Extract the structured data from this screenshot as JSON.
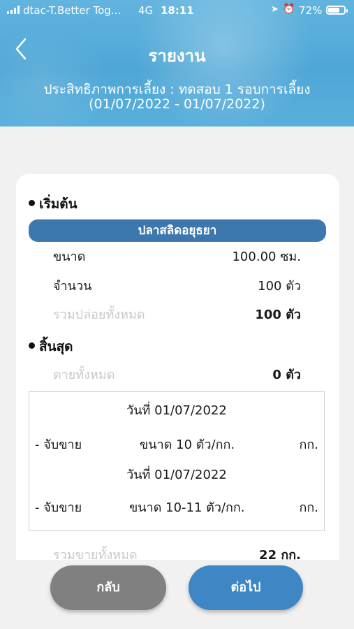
{
  "status_bar": {
    "carrier": "dtac-T.Better Tog...",
    "network": "4G",
    "time": "18:11",
    "battery": "72%",
    "battery_level": 0.72,
    "icons": [
      "signal-icon",
      "location-arrow-icon",
      "alarm-icon",
      "battery-icon"
    ]
  },
  "header": {
    "title": "รายงาน",
    "subtitle_line1": "ประสิทธิภาพการเลี้ยง : ทดสอบ 1 รอบการเลี้ยง",
    "subtitle_line2": "(01/07/2022 - 01/07/2022)",
    "back_icon": "chevron-left-icon"
  },
  "start_section": {
    "heading": "เริ่มต้น",
    "species": "ปลาสลิดอยุธยา",
    "size_label": "ขนาด",
    "size_value": "100.00 ซม.",
    "count_label": "จำนวน",
    "count_value": "100 ตัว",
    "total_release_label": "รวมปล่อยทั้งหมด",
    "total_release_value": "100 ตัว"
  },
  "end_section": {
    "heading": "สิ้นสุด",
    "dead_label": "ตายทั้งหมด",
    "dead_value": "0 ตัว",
    "sales": [
      {
        "date": "วันที่ 01/07/2022",
        "label": "- จับขาย",
        "size": "ขนาด 10 ตัว/กก.",
        "unit": "กก."
      },
      {
        "date": "วันที่ 01/07/2022",
        "label": "- จับขาย",
        "size": "ขนาด 10-11 ตัว/กก.",
        "unit": "กก."
      }
    ],
    "total_sold_label": "รวมขายทั้งหมด",
    "total_sold_value": "22 กก."
  },
  "buttons": {
    "back": "กลับ",
    "next": "ต่อไป"
  },
  "colors": {
    "header_blue": "#4ea6d6",
    "species_bar": "#3c78ad",
    "next_button": "#3f86c4",
    "back_button": "#808080"
  }
}
